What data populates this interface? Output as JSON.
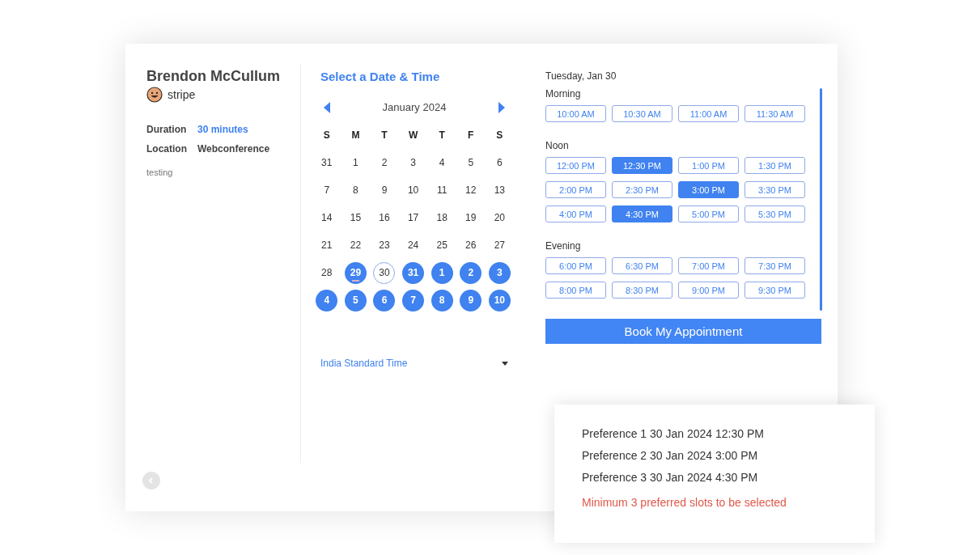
{
  "host": {
    "name": "Brendon McCullum",
    "company": "stripe",
    "details": [
      {
        "label": "Duration",
        "value": "30 minutes",
        "kind": "link"
      },
      {
        "label": "Location",
        "value": "Webconference",
        "kind": "plain"
      }
    ],
    "description": "testing"
  },
  "scheduler": {
    "title": "Select a Date & Time",
    "month": "January 2024",
    "weekdays": [
      "S",
      "M",
      "T",
      "W",
      "T",
      "F",
      "S"
    ],
    "days": [
      {
        "label": "31",
        "available": false,
        "selected": false,
        "today": false
      },
      {
        "label": "1",
        "available": false,
        "selected": false,
        "today": false
      },
      {
        "label": "2",
        "available": false,
        "selected": false,
        "today": false
      },
      {
        "label": "3",
        "available": false,
        "selected": false,
        "today": false
      },
      {
        "label": "4",
        "available": false,
        "selected": false,
        "today": false
      },
      {
        "label": "5",
        "available": false,
        "selected": false,
        "today": false
      },
      {
        "label": "6",
        "available": false,
        "selected": false,
        "today": false
      },
      {
        "label": "7",
        "available": false,
        "selected": false,
        "today": false
      },
      {
        "label": "8",
        "available": false,
        "selected": false,
        "today": false
      },
      {
        "label": "9",
        "available": false,
        "selected": false,
        "today": false
      },
      {
        "label": "10",
        "available": false,
        "selected": false,
        "today": false
      },
      {
        "label": "11",
        "available": false,
        "selected": false,
        "today": false
      },
      {
        "label": "12",
        "available": false,
        "selected": false,
        "today": false
      },
      {
        "label": "13",
        "available": false,
        "selected": false,
        "today": false
      },
      {
        "label": "14",
        "available": false,
        "selected": false,
        "today": false
      },
      {
        "label": "15",
        "available": false,
        "selected": false,
        "today": false
      },
      {
        "label": "16",
        "available": false,
        "selected": false,
        "today": false
      },
      {
        "label": "17",
        "available": false,
        "selected": false,
        "today": false
      },
      {
        "label": "18",
        "available": false,
        "selected": false,
        "today": false
      },
      {
        "label": "19",
        "available": false,
        "selected": false,
        "today": false
      },
      {
        "label": "20",
        "available": false,
        "selected": false,
        "today": false
      },
      {
        "label": "21",
        "available": false,
        "selected": false,
        "today": false
      },
      {
        "label": "22",
        "available": false,
        "selected": false,
        "today": false
      },
      {
        "label": "23",
        "available": false,
        "selected": false,
        "today": false
      },
      {
        "label": "24",
        "available": false,
        "selected": false,
        "today": false
      },
      {
        "label": "25",
        "available": false,
        "selected": false,
        "today": false
      },
      {
        "label": "26",
        "available": false,
        "selected": false,
        "today": false
      },
      {
        "label": "27",
        "available": false,
        "selected": false,
        "today": false
      },
      {
        "label": "28",
        "available": false,
        "selected": false,
        "today": false
      },
      {
        "label": "29",
        "available": true,
        "selected": false,
        "today": true
      },
      {
        "label": "30",
        "available": true,
        "selected": true,
        "today": false
      },
      {
        "label": "31",
        "available": true,
        "selected": false,
        "today": false
      },
      {
        "label": "1",
        "available": true,
        "selected": false,
        "today": false
      },
      {
        "label": "2",
        "available": true,
        "selected": false,
        "today": false
      },
      {
        "label": "3",
        "available": true,
        "selected": false,
        "today": false
      },
      {
        "label": "4",
        "available": true,
        "selected": false,
        "today": false
      },
      {
        "label": "5",
        "available": true,
        "selected": false,
        "today": false
      },
      {
        "label": "6",
        "available": true,
        "selected": false,
        "today": false
      },
      {
        "label": "7",
        "available": true,
        "selected": false,
        "today": false
      },
      {
        "label": "8",
        "available": true,
        "selected": false,
        "today": false
      },
      {
        "label": "9",
        "available": true,
        "selected": false,
        "today": false
      },
      {
        "label": "10",
        "available": true,
        "selected": false,
        "today": false
      }
    ],
    "timezone": "India Standard Time"
  },
  "slots": {
    "date": "Tuesday, Jan 30",
    "groups": [
      {
        "name": "Morning",
        "times": [
          {
            "label": "10:00 AM",
            "selected": false
          },
          {
            "label": "10:30 AM",
            "selected": false
          },
          {
            "label": "11:00 AM",
            "selected": false
          },
          {
            "label": "11:30 AM",
            "selected": false
          }
        ]
      },
      {
        "name": "Noon",
        "times": [
          {
            "label": "12:00 PM",
            "selected": false
          },
          {
            "label": "12:30 PM",
            "selected": true
          },
          {
            "label": "1:00 PM",
            "selected": false
          },
          {
            "label": "1:30 PM",
            "selected": false
          },
          {
            "label": "2:00 PM",
            "selected": false
          },
          {
            "label": "2:30 PM",
            "selected": false
          },
          {
            "label": "3:00 PM",
            "selected": true
          },
          {
            "label": "3:30 PM",
            "selected": false
          },
          {
            "label": "4:00 PM",
            "selected": false
          },
          {
            "label": "4:30 PM",
            "selected": true
          },
          {
            "label": "5:00 PM",
            "selected": false
          },
          {
            "label": "5:30 PM",
            "selected": false
          }
        ]
      },
      {
        "name": "Evening",
        "times": [
          {
            "label": "6:00 PM",
            "selected": false
          },
          {
            "label": "6:30 PM",
            "selected": false
          },
          {
            "label": "7:00 PM",
            "selected": false
          },
          {
            "label": "7:30 PM",
            "selected": false
          },
          {
            "label": "8:00 PM",
            "selected": false
          },
          {
            "label": "8:30 PM",
            "selected": false
          },
          {
            "label": "9:00 PM",
            "selected": false
          },
          {
            "label": "9:30 PM",
            "selected": false
          }
        ]
      }
    ],
    "book_button": "Book My Appointment"
  },
  "preferences": {
    "items": [
      "Preference 1 30 Jan 2024 12:30 PM",
      "Preference 2 30 Jan 2024 3:00 PM",
      "Preference 3 30 Jan 2024 4:30 PM"
    ],
    "error": "Minimum 3 preferred slots to be selected"
  }
}
